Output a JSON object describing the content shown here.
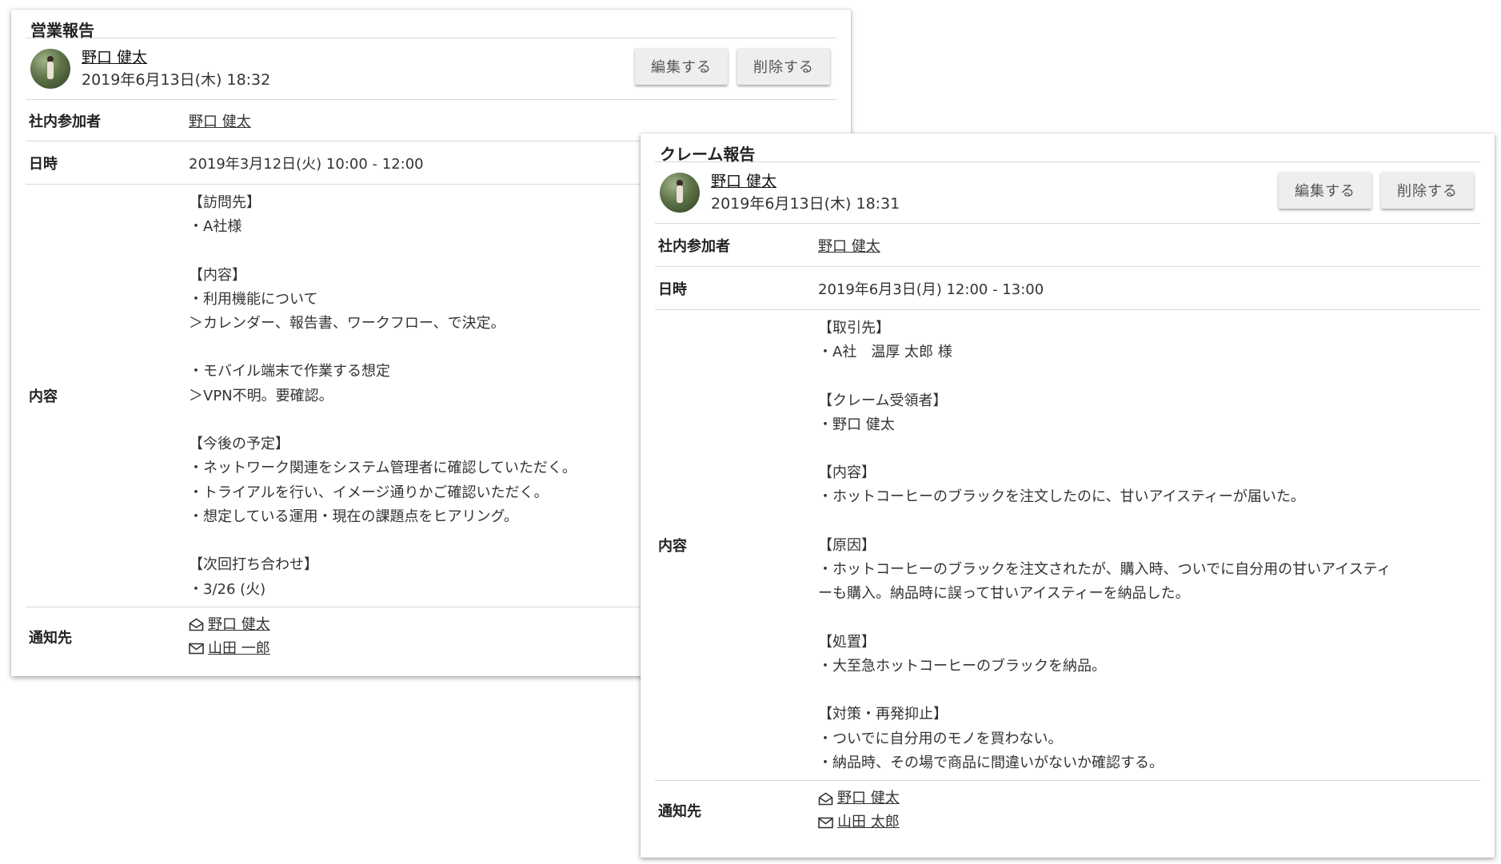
{
  "card1": {
    "title": "営業報告",
    "author": {
      "name": "野口 健太",
      "date": "2019年6月13日(木) 18:32"
    },
    "buttons": {
      "edit": "編集する",
      "delete": "削除する"
    },
    "participants": {
      "label": "社内参加者",
      "value": "野口 健太"
    },
    "datetime": {
      "label": "日時",
      "value": "2019年3月12日(火) 10:00 - 12:00"
    },
    "content": {
      "label": "内容",
      "lines": [
        "【訪問先】",
        "・A社様",
        "",
        "【内容】",
        "・利用機能について",
        "＞カレンダー、報告書、ワークフロー、で決定。",
        "",
        "・モバイル端末で作業する想定",
        "＞VPN不明。要確認。",
        "",
        "【今後の予定】",
        "・ネットワーク関連をシステム管理者に確認していただく。",
        "・トライアルを行い、イメージ通りかご確認いただく。",
        "・想定している運用・現在の課題点をヒアリング。",
        "",
        "【次回打ち合わせ】",
        "・3/26 (火)"
      ]
    },
    "notify": {
      "label": "通知先",
      "items": [
        {
          "icon": "envelope-open-icon",
          "name": "野口 健太"
        },
        {
          "icon": "envelope-icon",
          "name": "山田 一郎"
        }
      ]
    }
  },
  "card2": {
    "title": "クレーム報告",
    "author": {
      "name": "野口 健太",
      "date": "2019年6月13日(木) 18:31"
    },
    "buttons": {
      "edit": "編集する",
      "delete": "削除する"
    },
    "participants": {
      "label": "社内参加者",
      "value": "野口 健太"
    },
    "datetime": {
      "label": "日時",
      "value": "2019年6月3日(月) 12:00 - 13:00"
    },
    "content": {
      "label": "内容",
      "lines": [
        "【取引先】",
        "・A社　温厚 太郎 様",
        "",
        "【クレーム受領者】",
        "・野口 健太",
        "",
        "【内容】",
        "・ホットコーヒーのブラックを注文したのに、甘いアイスティーが届いた。",
        "",
        "【原因】",
        "・ホットコーヒーのブラックを注文されたが、購入時、ついでに自分用の甘いアイスティ",
        "ーも購入。納品時に誤って甘いアイスティーを納品した。",
        "",
        "【処置】",
        "・大至急ホットコーヒーのブラックを納品。",
        "",
        "【対策・再発抑止】",
        "・ついでに自分用のモノを買わない。",
        "・納品時、その場で商品に間違いがないか確認する。"
      ]
    },
    "notify": {
      "label": "通知先",
      "items": [
        {
          "icon": "envelope-open-icon",
          "name": "野口 健太"
        },
        {
          "icon": "envelope-icon",
          "name": "山田 太郎"
        }
      ]
    }
  }
}
